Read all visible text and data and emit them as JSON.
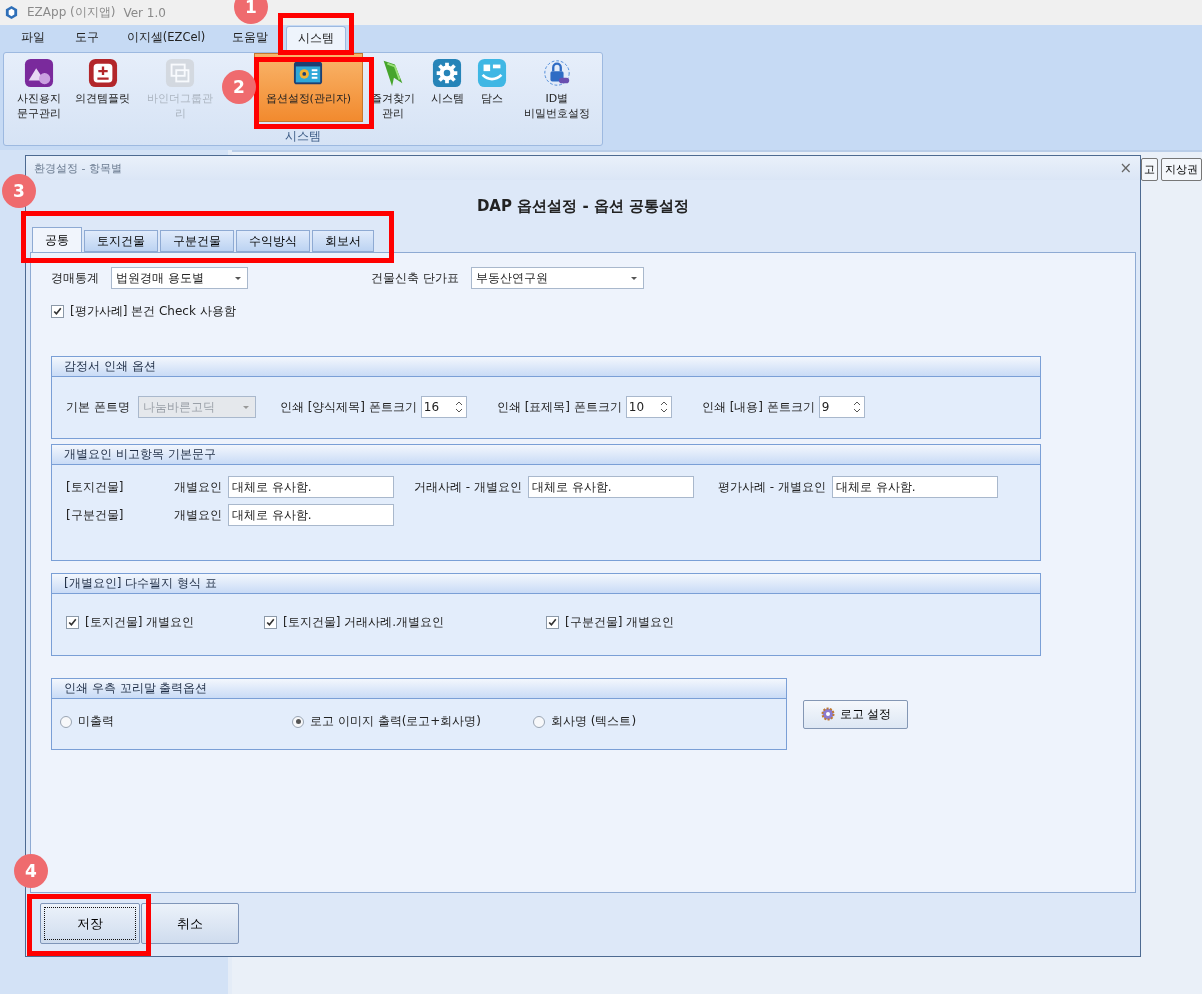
{
  "app": {
    "title": "EZApp (이지앱)",
    "version": "Ver 1.0"
  },
  "menu_tabs": [
    {
      "label": "파일",
      "selected": false
    },
    {
      "label": "도구",
      "selected": false
    },
    {
      "label": "이지셀(EZCel)",
      "selected": false
    },
    {
      "label": "도움말",
      "selected": false
    },
    {
      "label": "시스템",
      "selected": true
    }
  ],
  "ribbon": {
    "group": "시스템",
    "buttons": [
      {
        "label": "사진용지\n문구관리",
        "disabled": false,
        "selected": false
      },
      {
        "label": "의견템플릿",
        "disabled": false,
        "selected": false
      },
      {
        "label": "바인더그룹관리",
        "disabled": true,
        "selected": false
      },
      {
        "label": "옵션설정(관리자)",
        "disabled": false,
        "selected": true
      },
      {
        "label": "즐겨찾기\n관리",
        "disabled": false,
        "selected": false
      },
      {
        "label": "시스템",
        "disabled": false,
        "selected": false
      },
      {
        "label": "담스",
        "disabled": false,
        "selected": false
      },
      {
        "label": "ID별\n비밀번호설정",
        "disabled": false,
        "selected": false
      }
    ]
  },
  "background_buttons": [
    "고",
    "지상권"
  ],
  "dialog": {
    "title": "환경설정 - 항목별",
    "close": "×",
    "heading": "DAP 옵션설정 - 옵션 공통설정",
    "tabs": [
      {
        "label": "공통",
        "selected": true
      },
      {
        "label": "토지건물",
        "selected": false
      },
      {
        "label": "구분건물",
        "selected": false
      },
      {
        "label": "수익방식",
        "selected": false
      },
      {
        "label": "회보서",
        "selected": false
      }
    ],
    "top_fields": [
      {
        "label": "경매통계",
        "value": "법원경매 용도별"
      },
      {
        "label": "건물신축 단가표",
        "value": "부동산연구원"
      }
    ],
    "own_check": {
      "label": "[평가사례] 본건 Check 사용함",
      "checked": true
    },
    "print_options": {
      "title": "감정서 인쇄 옵션",
      "font": {
        "label": "기본 폰트명",
        "value": "나눔바른고딕",
        "disabled": true
      },
      "sizes": [
        {
          "label": "인쇄 [양식제목] 폰트크기",
          "value": "16"
        },
        {
          "label": "인쇄 [표제목] 폰트크기",
          "value": "10"
        },
        {
          "label": "인쇄 [내용] 폰트크기",
          "value": "9"
        }
      ]
    },
    "default_phrases": {
      "title": "개별요인 비고항목 기본문구",
      "rows": [
        {
          "group": "[토지건물]",
          "fields": [
            {
              "label": "개별요인",
              "value": "대체로 유사함."
            },
            {
              "label": "거래사례 - 개별요인",
              "value": "대체로 유사함."
            },
            {
              "label": "평가사례 - 개별요인",
              "value": "대체로 유사함."
            }
          ]
        },
        {
          "group": "[구분건물]",
          "fields": [
            {
              "label": "개별요인",
              "value": "대체로 유사함."
            }
          ]
        }
      ]
    },
    "multi_parcel": {
      "title": "[개별요인] 다수필지 형식 표",
      "checks": [
        {
          "label": "[토지건물] 개별요인",
          "checked": true
        },
        {
          "label": "[토지건물] 거래사례.개별요인",
          "checked": true
        },
        {
          "label": "[구분건물] 개별요인",
          "checked": true
        }
      ]
    },
    "footer_options": {
      "title": "인쇄 우측 꼬리말 출력옵션",
      "radios": [
        {
          "label": "미출력",
          "selected": false
        },
        {
          "label": "로고 이미지 출력(로고+회사명)",
          "selected": true
        },
        {
          "label": "회사명 (텍스트)",
          "selected": false
        }
      ]
    },
    "logo_button": "로고 설정",
    "buttons": [
      {
        "label": "저장",
        "focused": true
      },
      {
        "label": "취소",
        "focused": false
      }
    ]
  },
  "annotations": [
    {
      "number": "1"
    },
    {
      "number": "2"
    },
    {
      "number": "3"
    },
    {
      "number": "4"
    }
  ]
}
